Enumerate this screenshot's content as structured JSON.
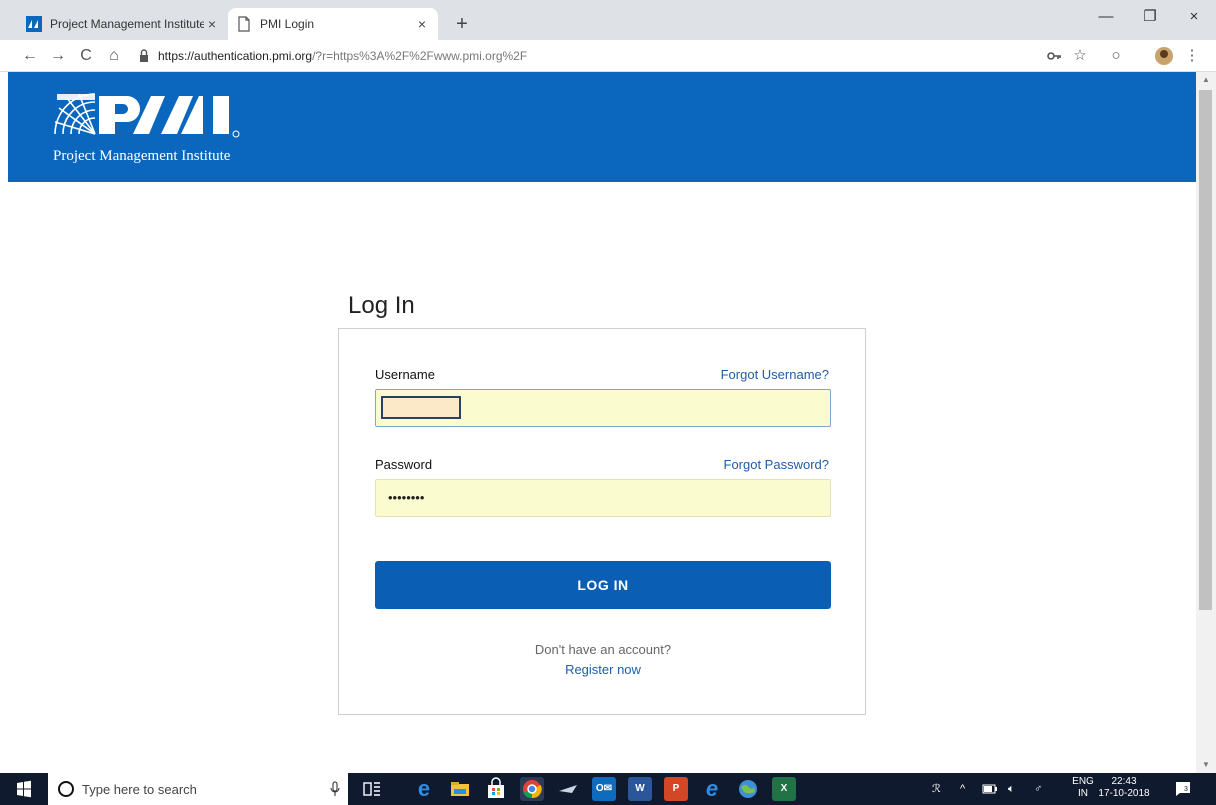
{
  "browser": {
    "tabs": [
      {
        "title": "Project Management Institute - P",
        "close": "×"
      },
      {
        "title": "PMI Login",
        "close": "×"
      }
    ],
    "new_tab": "+",
    "window_controls": {
      "minimize": "—",
      "maximize": "❐",
      "close": "×"
    },
    "nav": {
      "back": "←",
      "forward": "→",
      "reload": "C",
      "home": "⌂"
    },
    "url_host": "https://authentication.pmi.org",
    "url_rest": "/?r=https%3A%2F%2Fwww.pmi.org%2F",
    "icons": {
      "key": "key-icon",
      "star": "☆",
      "extension": "○",
      "menu": "⋮"
    }
  },
  "header": {
    "logo_text": "Project Management Institute",
    "logo_mark": "PMI",
    "brand_color": "#0a67bd"
  },
  "login": {
    "title": "Log In",
    "username_label": "Username",
    "forgot_username": "Forgot Username?",
    "password_label": "Password",
    "forgot_password": "Forgot Password?",
    "password_value": "••••••••",
    "button_label": "LOG IN",
    "no_account": "Don't have an account?",
    "register": "Register now"
  },
  "taskbar": {
    "search_placeholder": "Type here to search",
    "lang_top": "ENG",
    "lang_bottom": "IN",
    "time": "22:43",
    "date": "17-10-2018",
    "notification_count": "3"
  }
}
